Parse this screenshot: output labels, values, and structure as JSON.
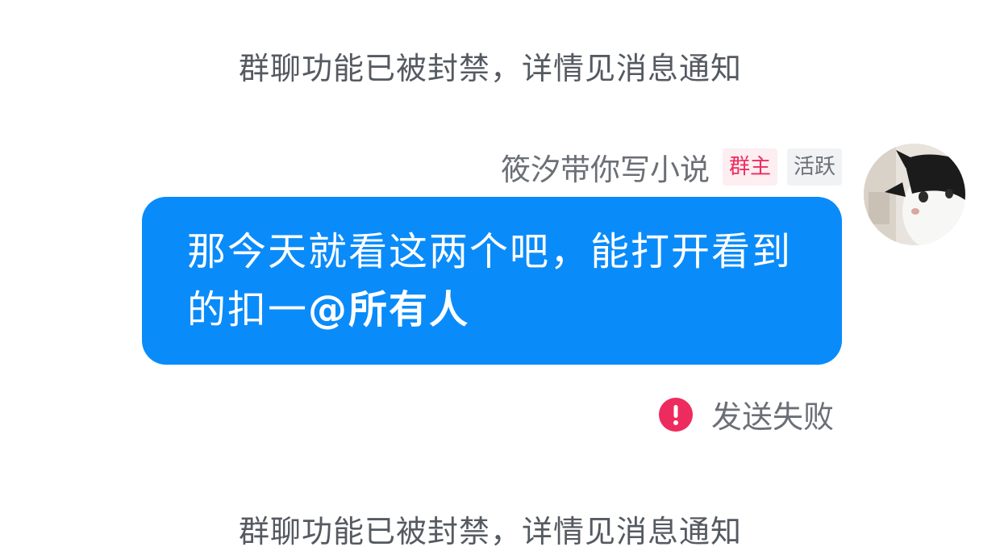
{
  "notices": {
    "top": "群聊功能已被封禁，详情见消息通知",
    "bottom": "群聊功能已被封禁，详情见消息通知"
  },
  "message": {
    "sender_name": "筱汐带你写小说",
    "tags": {
      "owner": "群主",
      "active": "活跃"
    },
    "text": "那今天就看这两个吧，能打开看到的扣一",
    "mention": "@所有人",
    "status": "发送失败",
    "status_icon": "error-exclamation-icon",
    "avatar": "cat-avatar"
  },
  "colors": {
    "bubble": "#0a8bfa",
    "owner_tag_text": "#ee2b5e",
    "owner_tag_bg": "#fdeef2",
    "error_icon": "#ee2b5e"
  }
}
